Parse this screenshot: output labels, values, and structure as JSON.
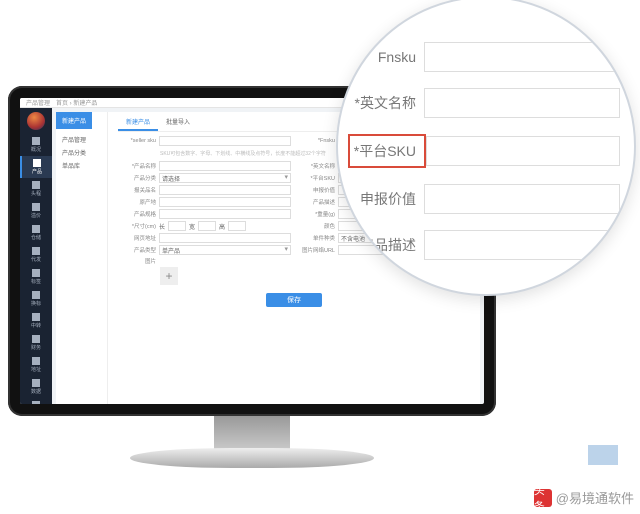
{
  "topbar": {
    "title": "产品管理",
    "path": "首页 › 新建产品"
  },
  "sidebar": {
    "items": [
      {
        "label": "概况"
      },
      {
        "label": "产品"
      },
      {
        "label": "头程"
      },
      {
        "label": "溢价"
      },
      {
        "label": "仓储"
      },
      {
        "label": "代发"
      },
      {
        "label": "标签"
      },
      {
        "label": "换标"
      },
      {
        "label": "中转"
      },
      {
        "label": "财务"
      },
      {
        "label": "地址"
      },
      {
        "label": "数据"
      },
      {
        "label": "设置"
      }
    ]
  },
  "leftcol": {
    "tab_active": "新建产品",
    "menu": [
      "产品管理",
      "产品分类",
      "单品库"
    ]
  },
  "tabs2": [
    "新建产品",
    "批量导入"
  ],
  "form": {
    "seller_sku": "*seller sku",
    "fnsku": "*Fnsku",
    "hint": "SKU可包含数字、字母、下划线、中横线及点符号，长度不能超过32个字符",
    "name": "*产品名称",
    "en_name": "*英文名称",
    "category": "产品分类",
    "category_val": "请选择",
    "platform_sku": "*平台SKU",
    "declare_name": "报关品名",
    "declare_value": "申报价值",
    "origin": "原产地",
    "product_desc": "产品描述",
    "spec": "产品规格",
    "weight": "*重量(g)",
    "size": "*尺寸(cm)",
    "size_labels": [
      "长",
      "宽",
      "高"
    ],
    "color": "颜色",
    "url": "网页地址",
    "kind": "单件种类",
    "kind_val": "不含电池",
    "type": "产品类型",
    "type_val": "单产品",
    "img_url": "图片网络URL",
    "img": "图片",
    "save": "保存"
  },
  "magnifier": {
    "rows": [
      {
        "label": "Fnsku"
      },
      {
        "label": "*英文名称"
      },
      {
        "label": "*平台SKU",
        "hl": true
      },
      {
        "label": "申报价值"
      },
      {
        "label": "产品描述"
      }
    ]
  },
  "watermark": {
    "prefix": "头条",
    "user": "@易境通软件"
  }
}
